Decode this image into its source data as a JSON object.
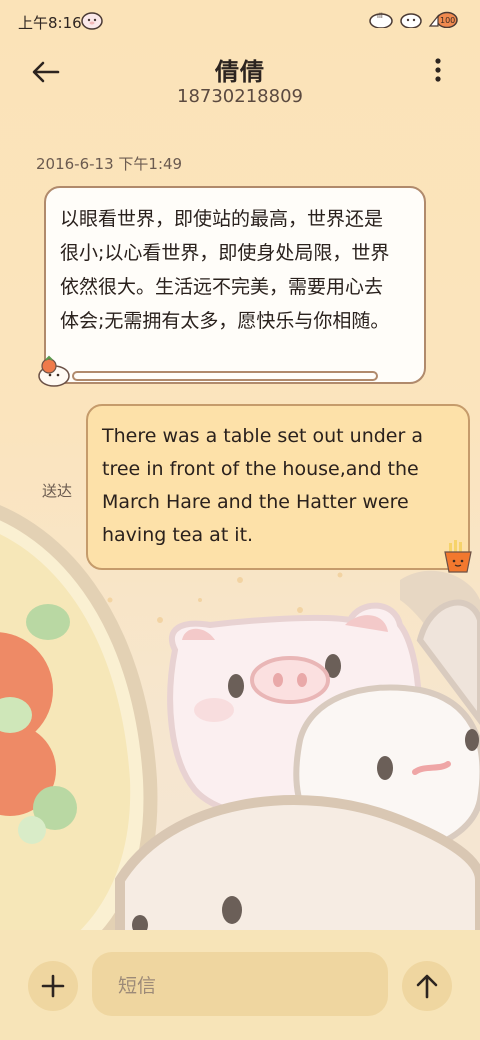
{
  "status_bar": {
    "time": "上午8:16",
    "battery_level": "100",
    "icons": [
      "status-sticker-icon",
      "signal-icon",
      "wifi-icon",
      "battery-icon"
    ]
  },
  "header": {
    "contact_name": "倩倩",
    "phone_number": "18730218809",
    "back_icon": "arrow-left-icon",
    "menu_icon": "more-vert-icon"
  },
  "conversation": {
    "timestamp": "2016-6-13 下午1:49",
    "incoming_message": "以眼看世界，即使站的最高，世界还是很小;以心看世界，即使身处局限，世界依然很大。生活远不完美，需要用心去体会;无需拥有太多，愿快乐与你相随。",
    "outgoing_message": "There was a table set out under a tree in front of the house,and the March Hare and the Hatter were having tea at it.",
    "delivery_status": "送达"
  },
  "composer": {
    "placeholder": "短信",
    "add_icon": "plus-icon",
    "send_icon": "arrow-up-icon"
  },
  "colors": {
    "background": "#fbe3b8",
    "incoming_bubble": "#fffdf9",
    "outgoing_bubble": "#fde1a9",
    "bubble_border": "#b08a6c",
    "accent_orange": "#e8633a"
  }
}
